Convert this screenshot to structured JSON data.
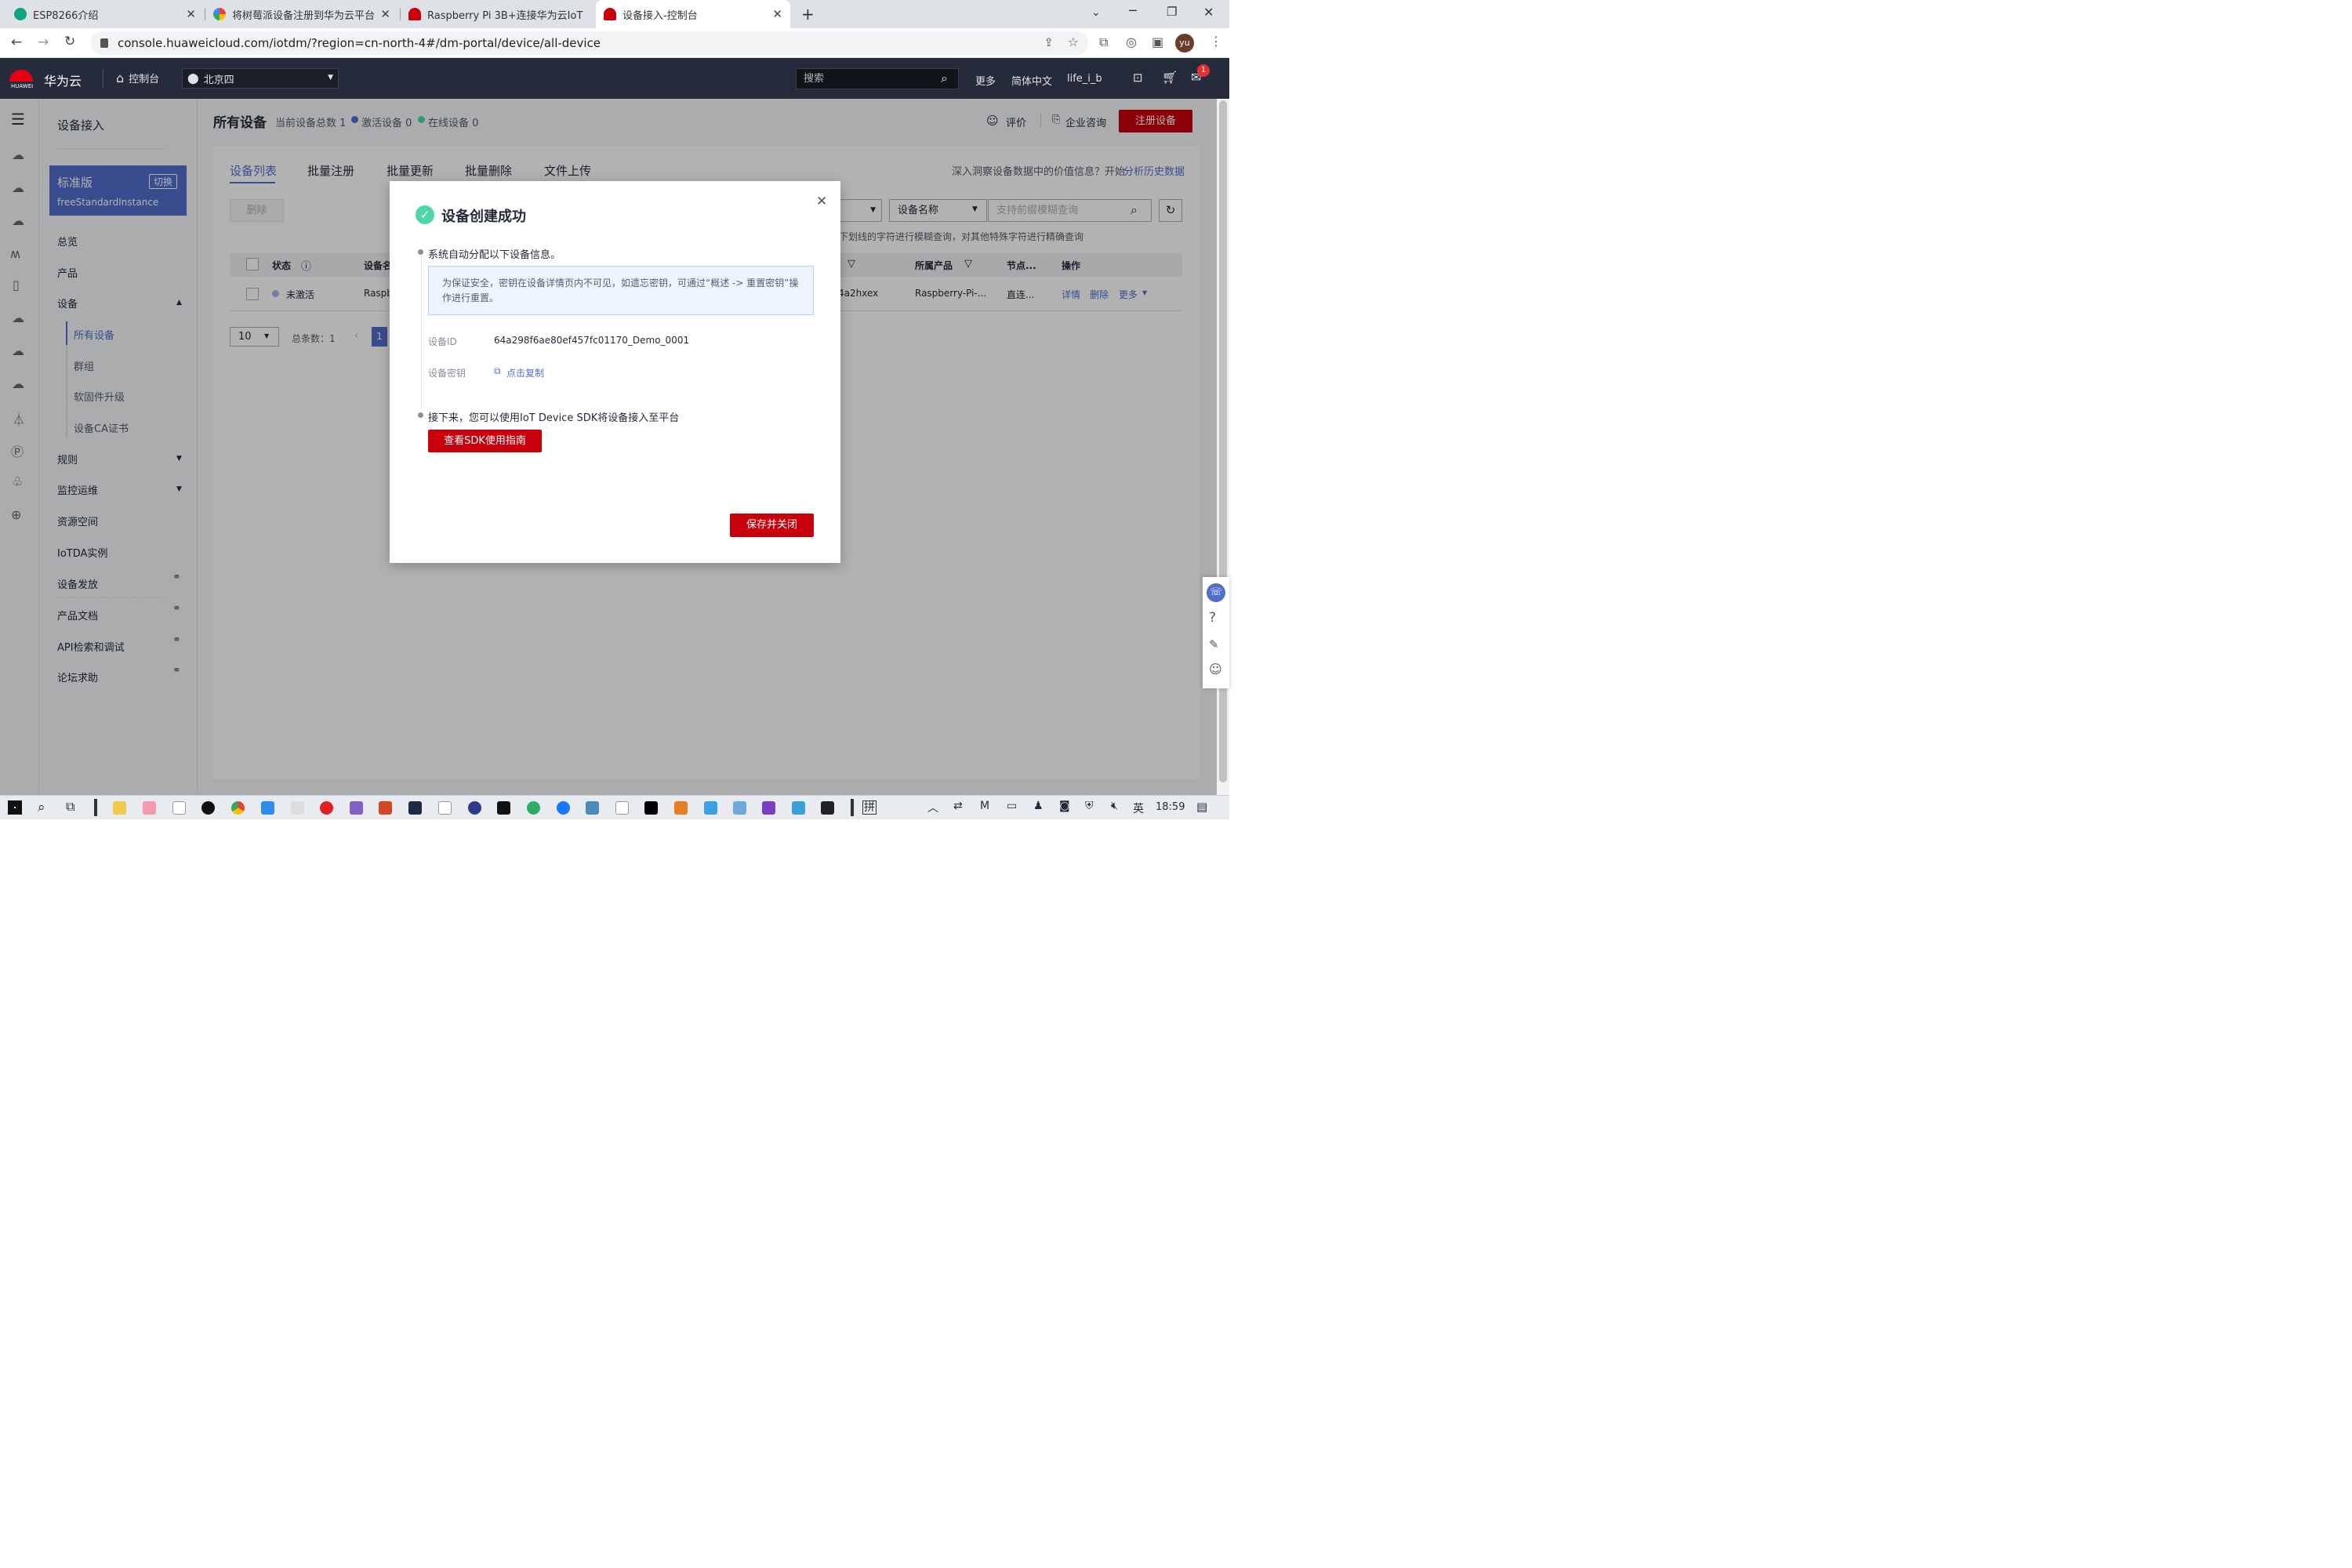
{
  "browser": {
    "tabs": [
      {
        "title": "ESP8266介绍",
        "icon": "chatgpt-icon",
        "color": "#10a37f"
      },
      {
        "title": "将树莓派设备注册到华为云平台",
        "icon": "google-icon",
        "color": "#4285f4"
      },
      {
        "title": "Raspberry Pi 3B+连接华为云IoT",
        "icon": "huawei-icon",
        "color": "#c7000b"
      },
      {
        "title": "设备接入-控制台",
        "icon": "huawei-icon",
        "color": "#c7000b"
      }
    ],
    "url": "console.huaweicloud.com/iotdm/?region=cn-north-4#/dm-portal/device/all-device",
    "profile": "yu"
  },
  "topnav": {
    "brand": "华为云",
    "brand_sub": "HUAWEI",
    "console": "控制台",
    "region": "北京四",
    "search_placeholder": "搜索",
    "more": "更多",
    "lang": "简体中文",
    "user": "life_i_b",
    "badge": "1"
  },
  "sidebar": {
    "title": "设备接入",
    "edition": "标准版",
    "switch": "切换",
    "instance": "freeStandardInstance",
    "items": [
      "总览",
      "产品",
      "设备",
      "规则",
      "监控运维",
      "资源空间",
      "IoTDA实例",
      "设备发放",
      "产品文档",
      "API检索和调试",
      "论坛求助"
    ],
    "sub_items": [
      "所有设备",
      "群组",
      "软固件升级",
      "设备CA证书"
    ]
  },
  "page": {
    "title": "所有设备",
    "total_label": "当前设备总数 1",
    "active_label": "激活设备 0",
    "online_label": "在线设备 0",
    "rate": "评价",
    "consult": "企业咨询",
    "register": "注册设备",
    "tabs": [
      "设备列表",
      "批量注册",
      "批量更新",
      "批量删除",
      "文件上传"
    ],
    "insight_text": "深入洞察设备数据中的价值信息？开始",
    "insight_link": "分析历史数据",
    "delete_btn": "删除",
    "filter_field": "设备名称",
    "filter_placeholder": "支持前缀模糊查询",
    "filter_hint": "下划线的字符进行模糊查询，对其他特殊字符进行精确查询",
    "table": {
      "headers": [
        "状态",
        "设备名",
        "所属产品",
        "节点...",
        "操作"
      ],
      "row": {
        "status": "未激活",
        "name": "Raspb",
        "id_tail": "4a2hxex",
        "product": "Raspberry-Pi-...",
        "node": "直连...",
        "detail": "详情",
        "delete": "删除",
        "more": "更多"
      }
    },
    "page_size": "10",
    "total_count": "总条数：1",
    "current_page": "1"
  },
  "dialog": {
    "title": "设备创建成功",
    "step1": "系统自动分配以下设备信息。",
    "notice": "为保证安全，密钥在设备详情页内不可见，如遗忘密钥，可通过“概述 -> 重置密钥”操作进行重置。",
    "device_id_label": "设备ID",
    "device_id": "64a298f6ae80ef457fc01170_Demo_0001",
    "secret_label": "设备密钥",
    "copy": "点击复制",
    "step2": "接下来，您可以使用IoT Device SDK将设备接入至平台",
    "sdk_button": "查看SDK使用指南",
    "save_close": "保存并关闭"
  },
  "taskbar": {
    "time": "18:59",
    "ime": "英",
    "ime2": "拼"
  },
  "colors": {
    "brand_red": "#c7000b",
    "nav_dark": "#252b3a",
    "primary_blue": "#526ecc",
    "success_green": "#50d4ab"
  }
}
